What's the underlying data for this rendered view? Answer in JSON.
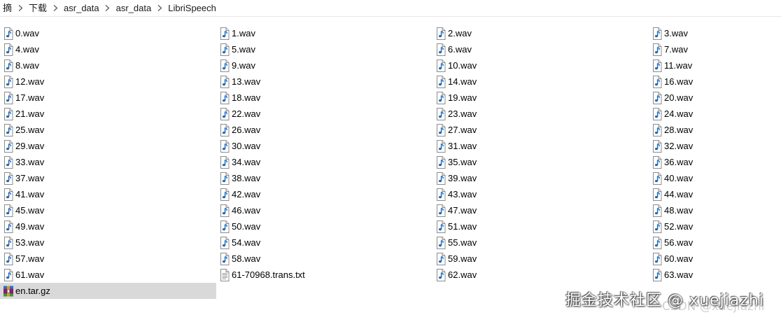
{
  "breadcrumb": {
    "items": [
      "摘",
      "下载",
      "asr_data",
      "asr_data",
      "LibriSpeech"
    ]
  },
  "colors": {
    "audio_icon_note": "#1e6bb8",
    "selection": "#d9d9d9",
    "archive_icon": "#8a1a7a"
  },
  "icons": {
    "audio": "audio-file-icon",
    "text": "text-file-icon",
    "archive": "archive-file-icon",
    "separator": "chevron-right-icon"
  },
  "files": [
    {
      "name": "0.wav",
      "type": "audio"
    },
    {
      "name": "1.wav",
      "type": "audio"
    },
    {
      "name": "2.wav",
      "type": "audio"
    },
    {
      "name": "3.wav",
      "type": "audio"
    },
    {
      "name": "4.wav",
      "type": "audio"
    },
    {
      "name": "5.wav",
      "type": "audio"
    },
    {
      "name": "6.wav",
      "type": "audio"
    },
    {
      "name": "7.wav",
      "type": "audio"
    },
    {
      "name": "8.wav",
      "type": "audio"
    },
    {
      "name": "9.wav",
      "type": "audio"
    },
    {
      "name": "10.wav",
      "type": "audio"
    },
    {
      "name": "11.wav",
      "type": "audio"
    },
    {
      "name": "12.wav",
      "type": "audio"
    },
    {
      "name": "13.wav",
      "type": "audio"
    },
    {
      "name": "14.wav",
      "type": "audio"
    },
    {
      "name": "16.wav",
      "type": "audio"
    },
    {
      "name": "17.wav",
      "type": "audio"
    },
    {
      "name": "18.wav",
      "type": "audio"
    },
    {
      "name": "19.wav",
      "type": "audio"
    },
    {
      "name": "20.wav",
      "type": "audio"
    },
    {
      "name": "21.wav",
      "type": "audio"
    },
    {
      "name": "22.wav",
      "type": "audio"
    },
    {
      "name": "23.wav",
      "type": "audio"
    },
    {
      "name": "24.wav",
      "type": "audio"
    },
    {
      "name": "25.wav",
      "type": "audio"
    },
    {
      "name": "26.wav",
      "type": "audio"
    },
    {
      "name": "27.wav",
      "type": "audio"
    },
    {
      "name": "28.wav",
      "type": "audio"
    },
    {
      "name": "29.wav",
      "type": "audio"
    },
    {
      "name": "30.wav",
      "type": "audio"
    },
    {
      "name": "31.wav",
      "type": "audio"
    },
    {
      "name": "32.wav",
      "type": "audio"
    },
    {
      "name": "33.wav",
      "type": "audio"
    },
    {
      "name": "34.wav",
      "type": "audio"
    },
    {
      "name": "35.wav",
      "type": "audio"
    },
    {
      "name": "36.wav",
      "type": "audio"
    },
    {
      "name": "37.wav",
      "type": "audio"
    },
    {
      "name": "38.wav",
      "type": "audio"
    },
    {
      "name": "39.wav",
      "type": "audio"
    },
    {
      "name": "40.wav",
      "type": "audio"
    },
    {
      "name": "41.wav",
      "type": "audio"
    },
    {
      "name": "42.wav",
      "type": "audio"
    },
    {
      "name": "43.wav",
      "type": "audio"
    },
    {
      "name": "44.wav",
      "type": "audio"
    },
    {
      "name": "45.wav",
      "type": "audio"
    },
    {
      "name": "46.wav",
      "type": "audio"
    },
    {
      "name": "47.wav",
      "type": "audio"
    },
    {
      "name": "48.wav",
      "type": "audio"
    },
    {
      "name": "49.wav",
      "type": "audio"
    },
    {
      "name": "50.wav",
      "type": "audio"
    },
    {
      "name": "51.wav",
      "type": "audio"
    },
    {
      "name": "52.wav",
      "type": "audio"
    },
    {
      "name": "53.wav",
      "type": "audio"
    },
    {
      "name": "54.wav",
      "type": "audio"
    },
    {
      "name": "55.wav",
      "type": "audio"
    },
    {
      "name": "56.wav",
      "type": "audio"
    },
    {
      "name": "57.wav",
      "type": "audio"
    },
    {
      "name": "58.wav",
      "type": "audio"
    },
    {
      "name": "59.wav",
      "type": "audio"
    },
    {
      "name": "60.wav",
      "type": "audio"
    },
    {
      "name": "61.wav",
      "type": "audio"
    },
    {
      "name": "61-70968.trans.txt",
      "type": "text"
    },
    {
      "name": "62.wav",
      "type": "audio"
    },
    {
      "name": "63.wav",
      "type": "audio"
    },
    {
      "name": "en.tar.gz",
      "type": "archive",
      "selected": true
    }
  ],
  "watermark": {
    "main": "掘金技术社区 @ xuejiazhi",
    "sub": "CSDN @xuejiazhi"
  }
}
